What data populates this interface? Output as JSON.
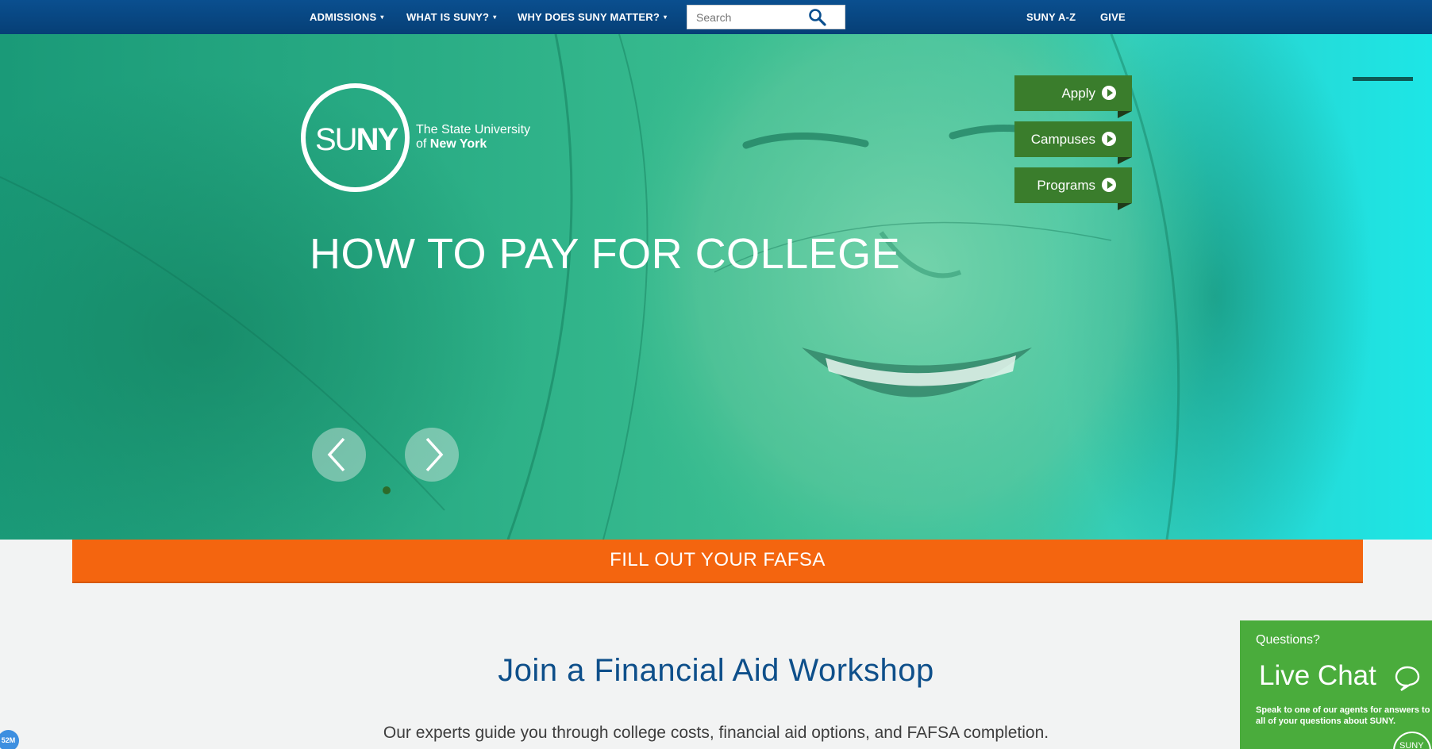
{
  "nav": {
    "left_items": [
      {
        "label": "ADMISSIONS",
        "caret": "▾"
      },
      {
        "label": "WHAT IS SUNY?",
        "caret": "▾"
      },
      {
        "label": "WHY DOES SUNY MATTER?",
        "caret": "▾"
      }
    ],
    "search_placeholder": "Search",
    "right_items": [
      "SUNY A-Z",
      "GIVE"
    ]
  },
  "logo": {
    "su": "SU",
    "ny": "NY",
    "line1": "The State University",
    "line2_prefix": "of",
    "line2_bold": "New York"
  },
  "quick_links": [
    "Apply",
    "Campuses",
    "Programs"
  ],
  "hero": {
    "title": "HOW TO PAY FOR COLLEGE"
  },
  "fafsa_label": "FILL OUT YOUR FAFSA",
  "section": {
    "title": "Join a Financial Aid Workshop",
    "description": "Our experts guide you through college costs, financial aid options, and FAFSA completion."
  },
  "live_chat": {
    "questions": "Questions?",
    "title": "Live Chat",
    "description": "Speak to one of our agents for answers to all of your questions about SUNY.",
    "badge": "SUNY"
  },
  "counter_badge": "52M",
  "colors": {
    "nav_blue": "#0a4f8f",
    "quicklink_green": "#3a7d2c",
    "fafsa_orange": "#f4650f",
    "title_blue": "#0e4f8a",
    "chat_green": "#4aac3c"
  }
}
